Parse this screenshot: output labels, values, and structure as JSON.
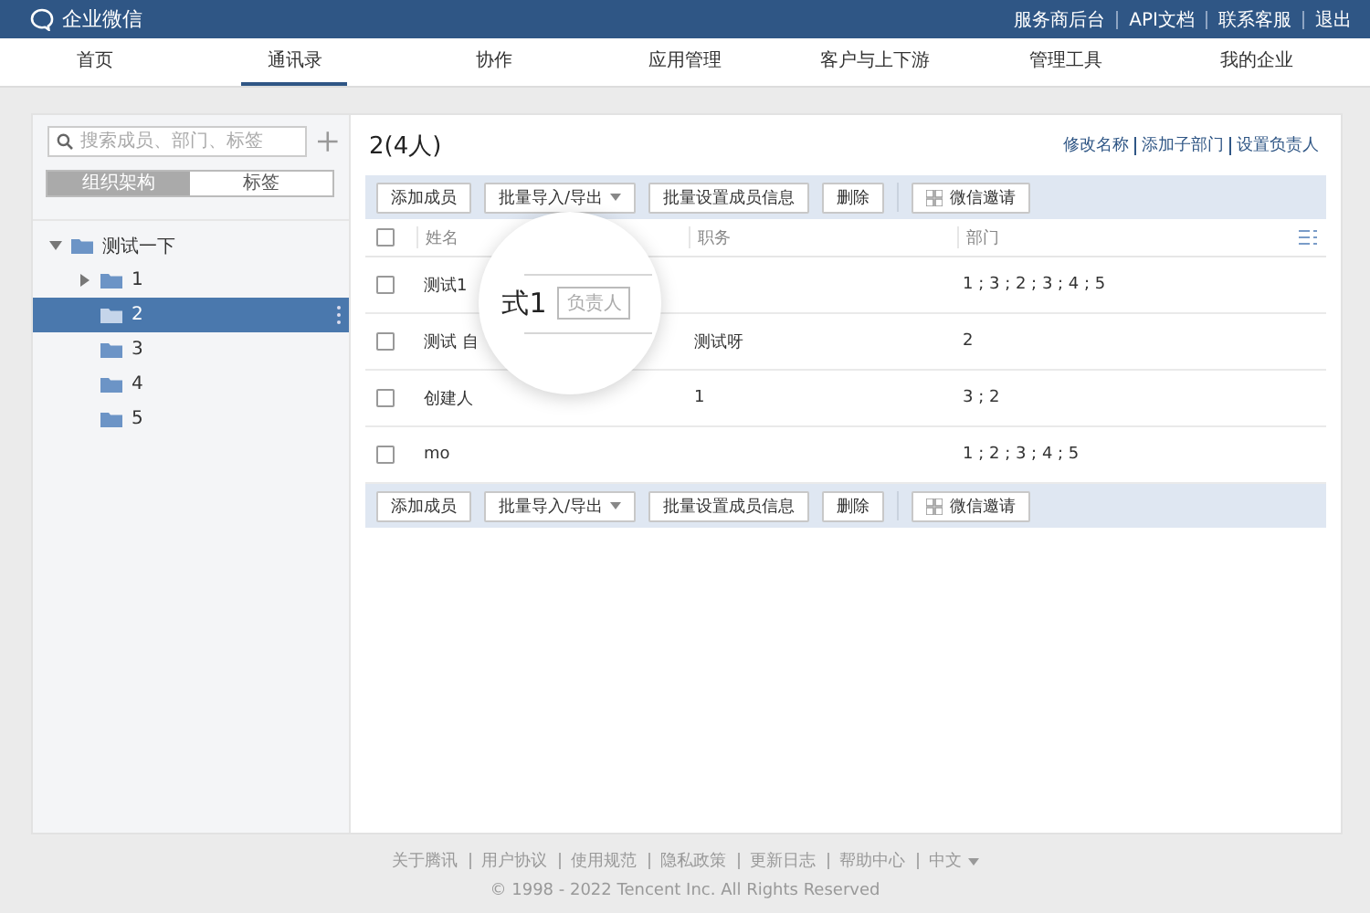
{
  "header": {
    "logo": "企业微信",
    "links": [
      "服务商后台",
      "API文档",
      "联系客服",
      "退出"
    ]
  },
  "nav": [
    {
      "label": "首页",
      "selected": false
    },
    {
      "label": "通讯录",
      "selected": true
    },
    {
      "label": "协作",
      "selected": false
    },
    {
      "label": "应用管理",
      "selected": false
    },
    {
      "label": "客户与上下游",
      "selected": false
    },
    {
      "label": "管理工具",
      "selected": false
    },
    {
      "label": "我的企业",
      "selected": false
    }
  ],
  "sidebar": {
    "search": {
      "placeholder": "搜索成员、部门、标签"
    },
    "tabs": [
      {
        "label": "组织架构",
        "selected": true
      },
      {
        "label": "标签",
        "selected": false
      }
    ],
    "tree": [
      {
        "label": "测试一下",
        "expanded": true,
        "selected": false,
        "children": [
          {
            "label": "1",
            "expanded": false,
            "selected": false,
            "has_children": true
          },
          {
            "label": "2",
            "expanded": false,
            "selected": true,
            "has_children": false
          },
          {
            "label": "3",
            "expanded": false,
            "selected": false,
            "has_children": false
          },
          {
            "label": "4",
            "expanded": false,
            "selected": false,
            "has_children": false
          },
          {
            "label": "5",
            "expanded": false,
            "selected": false,
            "has_children": false
          }
        ],
        "has_children": true
      }
    ]
  },
  "department": {
    "title": "2(4人)",
    "actions": [
      "修改名称",
      "添加子部门",
      "设置负责人"
    ]
  },
  "toolbar_top": [
    {
      "label": "添加成员",
      "kind": "plain"
    },
    {
      "label": "批量导入/导出",
      "kind": "dropdown"
    },
    {
      "label": "批量设置成员信息",
      "kind": "plain"
    },
    {
      "label": "删除",
      "kind": "plain"
    },
    {
      "label": "微信邀请",
      "kind": "qr"
    }
  ],
  "table": {
    "header_checked": false,
    "columns": [
      "姓名",
      "职务",
      "部门"
    ],
    "rows": [
      {
        "checked": false,
        "cells": [
          "测试1",
          "",
          "1 ; 3 ; 2 ; 3 ; 4 ; 5"
        ]
      },
      {
        "checked": false,
        "cells": [
          "测试 自",
          "测试呀",
          "2"
        ]
      },
      {
        "checked": false,
        "cells": [
          "创建人",
          "1",
          "3 ; 2"
        ]
      },
      {
        "checked": false,
        "cells": [
          "mo",
          "",
          "1 ; 2 ; 3 ; 4 ; 5"
        ]
      }
    ]
  },
  "toolbar_bottom": [
    {
      "label": "添加成员",
      "kind": "plain"
    },
    {
      "label": "批量导入/导出",
      "kind": "dropdown"
    },
    {
      "label": "批量设置成员信息",
      "kind": "plain"
    },
    {
      "label": "删除",
      "kind": "plain"
    },
    {
      "label": "微信邀请",
      "kind": "qr"
    }
  ],
  "magnifier": {
    "text": "式1",
    "tag": "负责人"
  },
  "footer": {
    "links": [
      {
        "label": "关于腾讯",
        "kind": "link"
      },
      {
        "label": "用户协议",
        "kind": "link"
      },
      {
        "label": "使用规范",
        "kind": "link"
      },
      {
        "label": "隐私政策",
        "kind": "link"
      },
      {
        "label": "更新日志",
        "kind": "link"
      },
      {
        "label": "帮助中心",
        "kind": "link"
      },
      {
        "label": "中文",
        "kind": "dropdown"
      }
    ],
    "copyright": "© 1998 - 2022 Tencent Inc. All Rights Reserved"
  }
}
